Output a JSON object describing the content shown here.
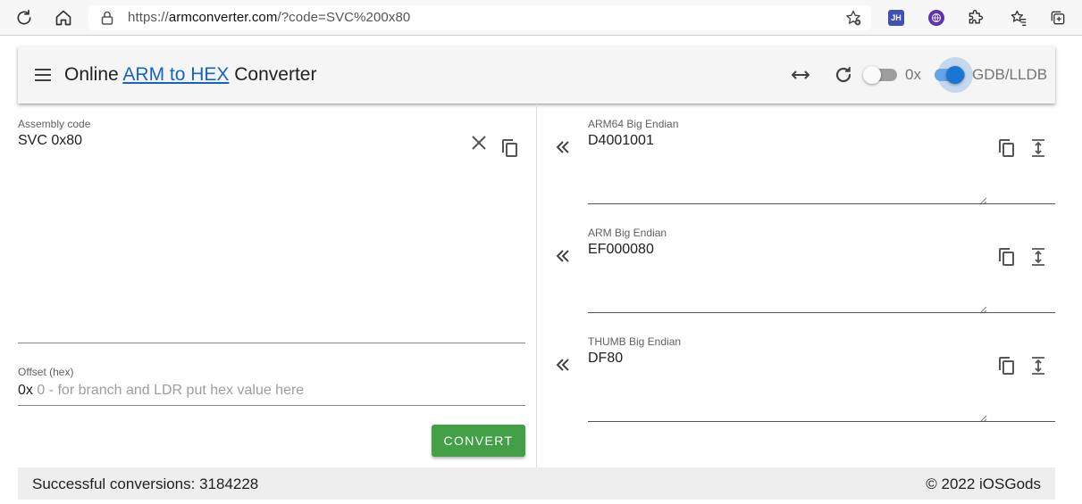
{
  "browser": {
    "url_prefix": "https://",
    "url_domain": "armconverter.com",
    "url_path": "/?code=SVC%200x80",
    "ext_jh": "JH"
  },
  "header": {
    "title_before": "Online ",
    "title_link": "ARM to HEX",
    "title_after": " Converter",
    "toggle_0x_label": "0x",
    "toggle_0x_on": false,
    "toggle_gdb_label": "GDB/LLDB",
    "toggle_gdb_on": true,
    "accent_color": "#1976d2"
  },
  "input": {
    "assembly_label": "Assembly code",
    "assembly_value": "SVC 0x80",
    "offset_label": "Offset (hex)",
    "offset_prefix": "0x",
    "offset_placeholder": "0 - for branch and LDR put hex value here",
    "convert_label": "CONVERT"
  },
  "outputs": [
    {
      "label": "ARM64 Big Endian",
      "value": "D4001001"
    },
    {
      "label": "ARM Big Endian",
      "value": "EF000080"
    },
    {
      "label": "THUMB Big Endian",
      "value": "DF80"
    }
  ],
  "footer": {
    "conversions": "Successful conversions: 3184228",
    "copyright": "© 2022 iOSGods"
  }
}
